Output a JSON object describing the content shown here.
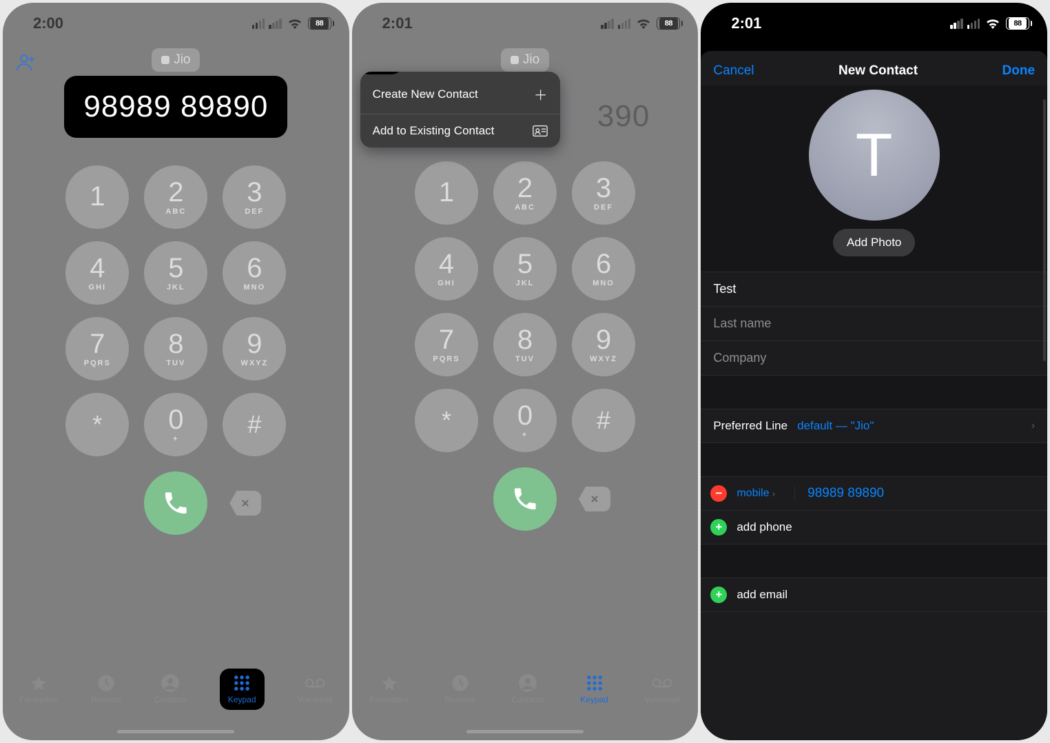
{
  "colors": {
    "ios_blue": "#0a84ff",
    "ios_green": "#30d158",
    "ios_red": "#ff3b30",
    "call_green": "#7fc18f"
  },
  "keypad_rows": [
    [
      {
        "n": "1",
        "l": " "
      },
      {
        "n": "2",
        "l": "ABC"
      },
      {
        "n": "3",
        "l": "DEF"
      }
    ],
    [
      {
        "n": "4",
        "l": "GHI"
      },
      {
        "n": "5",
        "l": "JKL"
      },
      {
        "n": "6",
        "l": "MNO"
      }
    ],
    [
      {
        "n": "7",
        "l": "PQRS"
      },
      {
        "n": "8",
        "l": "TUV"
      },
      {
        "n": "9",
        "l": "WXYZ"
      }
    ],
    [
      {
        "n": "*",
        "l": ""
      },
      {
        "n": "0",
        "l": "+"
      },
      {
        "n": "#",
        "l": ""
      }
    ]
  ],
  "screen1": {
    "time": "2:00",
    "battery": "88",
    "carrier": "Jio",
    "dialed": "98989 89890",
    "tabs": [
      {
        "label": "Favourites"
      },
      {
        "label": "Recents"
      },
      {
        "label": "Contacts"
      },
      {
        "label": "Keypad"
      },
      {
        "label": "Voicemail"
      }
    ],
    "active_tab": "Keypad"
  },
  "screen2": {
    "time": "2:01",
    "battery": "88",
    "carrier": "Jio",
    "dialed_tail": "390",
    "menu": {
      "create": "Create New Contact",
      "add_existing": "Add to Existing Contact"
    },
    "tabs": [
      {
        "label": "Favourites"
      },
      {
        "label": "Recents"
      },
      {
        "label": "Contacts"
      },
      {
        "label": "Keypad"
      },
      {
        "label": "Voicemail"
      }
    ],
    "active_tab": "Keypad"
  },
  "screen3": {
    "time": "2:01",
    "battery": "88",
    "cancel": "Cancel",
    "title": "New Contact",
    "done": "Done",
    "avatar_letter": "T",
    "add_photo": "Add Photo",
    "first_name_value": "Test",
    "last_name_placeholder": "Last name",
    "company_placeholder": "Company",
    "preferred_line_label": "Preferred Line",
    "preferred_line_value": "default — \"Jio\"",
    "phone_type": "mobile",
    "phone_number": "98989 89890",
    "add_phone": "add phone",
    "add_email": "add email"
  }
}
